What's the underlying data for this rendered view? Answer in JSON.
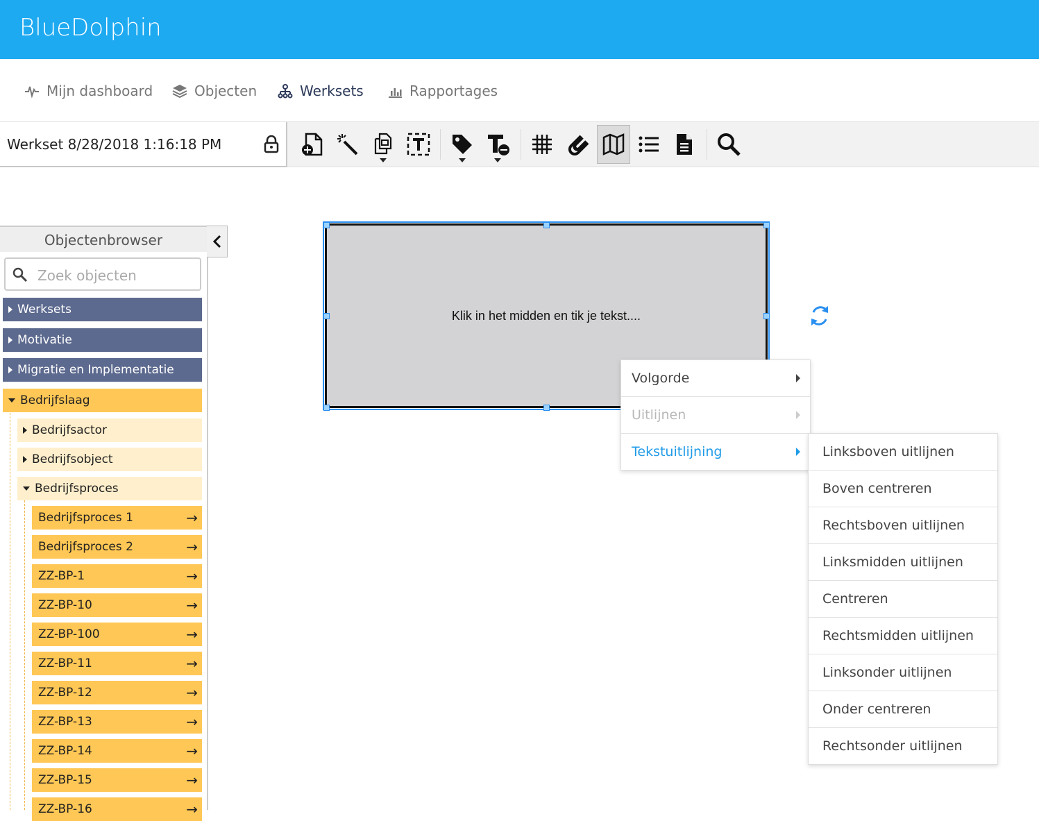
{
  "app": {
    "title": "BlueDolphin"
  },
  "nav": {
    "items": [
      {
        "label": "Mijn dashboard",
        "icon": "pulse-icon"
      },
      {
        "label": "Objecten",
        "icon": "layers-icon"
      },
      {
        "label": "Werksets",
        "icon": "hierarchy-icon",
        "active": true
      },
      {
        "label": "Rapportages",
        "icon": "bar-chart-icon"
      }
    ]
  },
  "toolbar": {
    "werkset_name": "Werkset 8/28/2018 1:16:18 PM",
    "buttons": [
      "add-object-icon",
      "magic-wand-icon",
      "copy-objects-icon",
      "text-box-icon",
      "tag-icon",
      "text-style-icon",
      "grid-icon",
      "magnet-icon",
      "map-icon",
      "list-icon",
      "document-icon",
      "search-icon"
    ]
  },
  "browser": {
    "title": "Objectenbrowser",
    "search_placeholder": "Zoek objecten",
    "groups": [
      {
        "label": "Werksets"
      },
      {
        "label": "Motivatie"
      },
      {
        "label": "Migratie en Implementatie"
      },
      {
        "label": "Bedrijfslaag"
      }
    ],
    "subgroups": [
      {
        "label": "Bedrijfsactor"
      },
      {
        "label": "Bedrijfsobject"
      },
      {
        "label": "Bedrijfsproces"
      }
    ],
    "items": [
      {
        "label": "Bedrijfsproces 1"
      },
      {
        "label": "Bedrijfsproces 2"
      },
      {
        "label": "ZZ-BP-1"
      },
      {
        "label": "ZZ-BP-10"
      },
      {
        "label": "ZZ-BP-100"
      },
      {
        "label": "ZZ-BP-11"
      },
      {
        "label": "ZZ-BP-12"
      },
      {
        "label": "ZZ-BP-13"
      },
      {
        "label": "ZZ-BP-14"
      },
      {
        "label": "ZZ-BP-15"
      },
      {
        "label": "ZZ-BP-16"
      }
    ],
    "arrow": "→"
  },
  "canvas": {
    "shape_text": "Klik in het midden en tik je tekst...."
  },
  "context_menu": {
    "items": [
      {
        "label": "Volgorde",
        "state": "normal"
      },
      {
        "label": "Uitlijnen",
        "state": "disabled"
      },
      {
        "label": "Tekstuitlijning",
        "state": "active"
      }
    ],
    "submenu": [
      {
        "label": "Linksboven uitlijnen"
      },
      {
        "label": "Boven centreren"
      },
      {
        "label": "Rechtsboven uitlijnen"
      },
      {
        "label": "Linksmidden uitlijnen"
      },
      {
        "label": "Centreren"
      },
      {
        "label": "Rechtsmidden uitlijnen"
      },
      {
        "label": "Linksonder uitlijnen"
      },
      {
        "label": "Onder centreren"
      },
      {
        "label": "Rechtsonder uitlijnen"
      }
    ]
  },
  "colors": {
    "header": "#1eaaf1",
    "group_dark": "#5d6a8f",
    "group_orange": "#ffc755",
    "subgroup_light": "#ffefcc",
    "menu_active": "#1f9be8"
  }
}
